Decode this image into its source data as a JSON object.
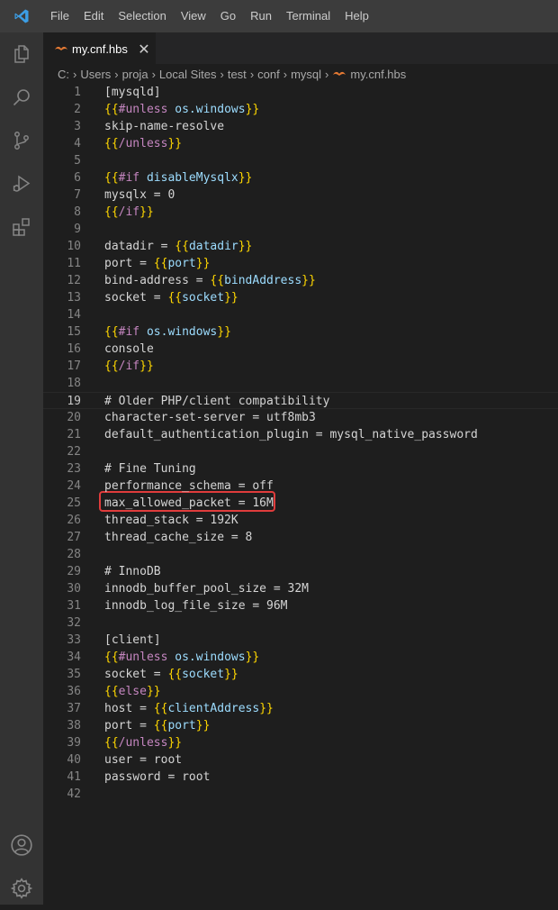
{
  "menu": {
    "items": [
      "File",
      "Edit",
      "Selection",
      "View",
      "Go",
      "Run",
      "Terminal",
      "Help"
    ]
  },
  "activity_bar": {
    "top_icons": [
      "explorer-icon",
      "search-icon",
      "source-control-icon",
      "run-debug-icon",
      "extensions-icon"
    ],
    "bottom_icons": [
      "account-icon",
      "manage-gear-icon"
    ]
  },
  "tab": {
    "label": "my.cnf.hbs",
    "close": "✕"
  },
  "breadcrumb": {
    "parts": [
      "C:",
      "Users",
      "proja",
      "Local Sites",
      "test",
      "conf",
      "mysql",
      "my.cnf.hbs"
    ]
  },
  "editor": {
    "current_line": 19,
    "highlighted_line": 25,
    "lines": [
      [
        [
          "p",
          "[mysqld]"
        ]
      ],
      [
        [
          "b",
          "{{"
        ],
        [
          "k",
          "#unless "
        ],
        [
          "v",
          "os.windows"
        ],
        [
          "b",
          "}}"
        ]
      ],
      [
        [
          "p",
          "skip-name-resolve"
        ]
      ],
      [
        [
          "b",
          "{{"
        ],
        [
          "k",
          "/unless"
        ],
        [
          "b",
          "}}"
        ]
      ],
      [],
      [
        [
          "b",
          "{{"
        ],
        [
          "k",
          "#if "
        ],
        [
          "v",
          "disableMysqlx"
        ],
        [
          "b",
          "}}"
        ]
      ],
      [
        [
          "p",
          "mysqlx = 0"
        ]
      ],
      [
        [
          "b",
          "{{"
        ],
        [
          "k",
          "/if"
        ],
        [
          "b",
          "}}"
        ]
      ],
      [],
      [
        [
          "p",
          "datadir = "
        ],
        [
          "b",
          "{{"
        ],
        [
          "v",
          "datadir"
        ],
        [
          "b",
          "}}"
        ]
      ],
      [
        [
          "p",
          "port = "
        ],
        [
          "b",
          "{{"
        ],
        [
          "v",
          "port"
        ],
        [
          "b",
          "}}"
        ]
      ],
      [
        [
          "p",
          "bind-address = "
        ],
        [
          "b",
          "{{"
        ],
        [
          "v",
          "bindAddress"
        ],
        [
          "b",
          "}}"
        ]
      ],
      [
        [
          "p",
          "socket = "
        ],
        [
          "b",
          "{{"
        ],
        [
          "v",
          "socket"
        ],
        [
          "b",
          "}}"
        ]
      ],
      [],
      [
        [
          "b",
          "{{"
        ],
        [
          "k",
          "#if "
        ],
        [
          "v",
          "os.windows"
        ],
        [
          "b",
          "}}"
        ]
      ],
      [
        [
          "p",
          "console"
        ]
      ],
      [
        [
          "b",
          "{{"
        ],
        [
          "k",
          "/if"
        ],
        [
          "b",
          "}}"
        ]
      ],
      [],
      [
        [
          "p",
          "# Older PHP/client compatibility"
        ]
      ],
      [
        [
          "p",
          "character-set-server = utf8mb3"
        ]
      ],
      [
        [
          "p",
          "default_authentication_plugin = mysql_native_password"
        ]
      ],
      [],
      [
        [
          "p",
          "# Fine Tuning"
        ]
      ],
      [
        [
          "p",
          "performance_schema = off"
        ]
      ],
      [
        [
          "p",
          "max_allowed_packet = 16M"
        ]
      ],
      [
        [
          "p",
          "thread_stack = 192K"
        ]
      ],
      [
        [
          "p",
          "thread_cache_size = 8"
        ]
      ],
      [],
      [
        [
          "p",
          "# InnoDB"
        ]
      ],
      [
        [
          "p",
          "innodb_buffer_pool_size = 32M"
        ]
      ],
      [
        [
          "p",
          "innodb_log_file_size = 96M"
        ]
      ],
      [],
      [
        [
          "p",
          "[client]"
        ]
      ],
      [
        [
          "b",
          "{{"
        ],
        [
          "k",
          "#unless "
        ],
        [
          "v",
          "os.windows"
        ],
        [
          "b",
          "}}"
        ]
      ],
      [
        [
          "p",
          "socket = "
        ],
        [
          "b",
          "{{"
        ],
        [
          "v",
          "socket"
        ],
        [
          "b",
          "}}"
        ]
      ],
      [
        [
          "b",
          "{{"
        ],
        [
          "k",
          "else"
        ],
        [
          "b",
          "}}"
        ]
      ],
      [
        [
          "p",
          "host = "
        ],
        [
          "b",
          "{{"
        ],
        [
          "v",
          "clientAddress"
        ],
        [
          "b",
          "}}"
        ]
      ],
      [
        [
          "p",
          "port = "
        ],
        [
          "b",
          "{{"
        ],
        [
          "v",
          "port"
        ],
        [
          "b",
          "}}"
        ]
      ],
      [
        [
          "b",
          "{{"
        ],
        [
          "k",
          "/unless"
        ],
        [
          "b",
          "}}"
        ]
      ],
      [
        [
          "p",
          "user = root"
        ]
      ],
      [
        [
          "p",
          "password = root"
        ]
      ],
      []
    ]
  },
  "colors": {
    "accent_vscode_blue": "#3c9ee5",
    "hbs_icon_orange": "#e37933",
    "highlight_red": "#e03c3c"
  }
}
